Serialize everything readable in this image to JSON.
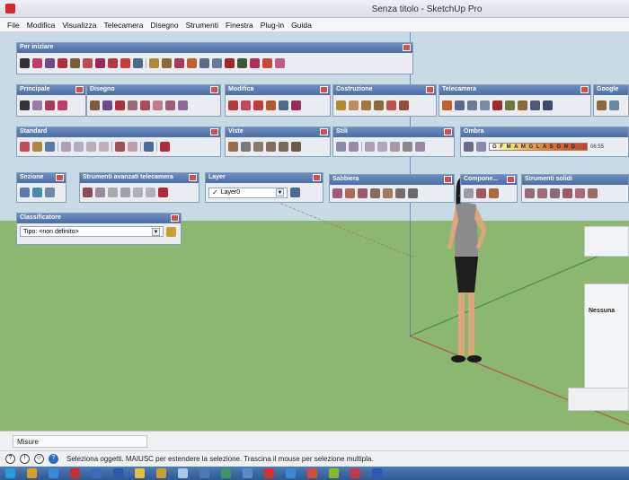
{
  "window": {
    "title": "Senza titolo - SketchUp Pro"
  },
  "menu": [
    "File",
    "Modifica",
    "Visualizza",
    "Telecamera",
    "Disegno",
    "Strumenti",
    "Finestra",
    "Plug-in",
    "Guida"
  ],
  "toolbars": {
    "per_iniziare": "Per iniziare",
    "principale": "Principale",
    "disegno": "Disegno",
    "modifica": "Modifica",
    "costruzione": "Costruzione",
    "telecamera": "Telecamera",
    "google": "Google",
    "standard": "Standard",
    "viste": "Viste",
    "stili": "Stili",
    "ombra": "Ombra",
    "sezione": "Sezione",
    "strumenti_avanzati": "Strumenti avanzati telecamera",
    "layer": "Layer",
    "sabbiera": "Sabbiera",
    "componenti": "Compone...",
    "strumenti_solidi": "Strumenti solidi",
    "classificatore": "Classificatore"
  },
  "layer": {
    "current": "Layer0"
  },
  "classificatore": {
    "tipo": "Tipo: <non definito>"
  },
  "ombra": {
    "months": "G F M A M G L A S O N D",
    "time": "06:55"
  },
  "right_panel": {
    "label": "Nessuna"
  },
  "measure": {
    "label": "Misure"
  },
  "status": {
    "text": "Seleziona oggetti. MAIUSC per estendere la selezione. Trascina il mouse per selezione multipla."
  },
  "colors": {
    "toolbar_header": "#4c6fa6",
    "sky": "#c7dbe6",
    "ground": "#8bb771",
    "close": "#d94a4a"
  }
}
